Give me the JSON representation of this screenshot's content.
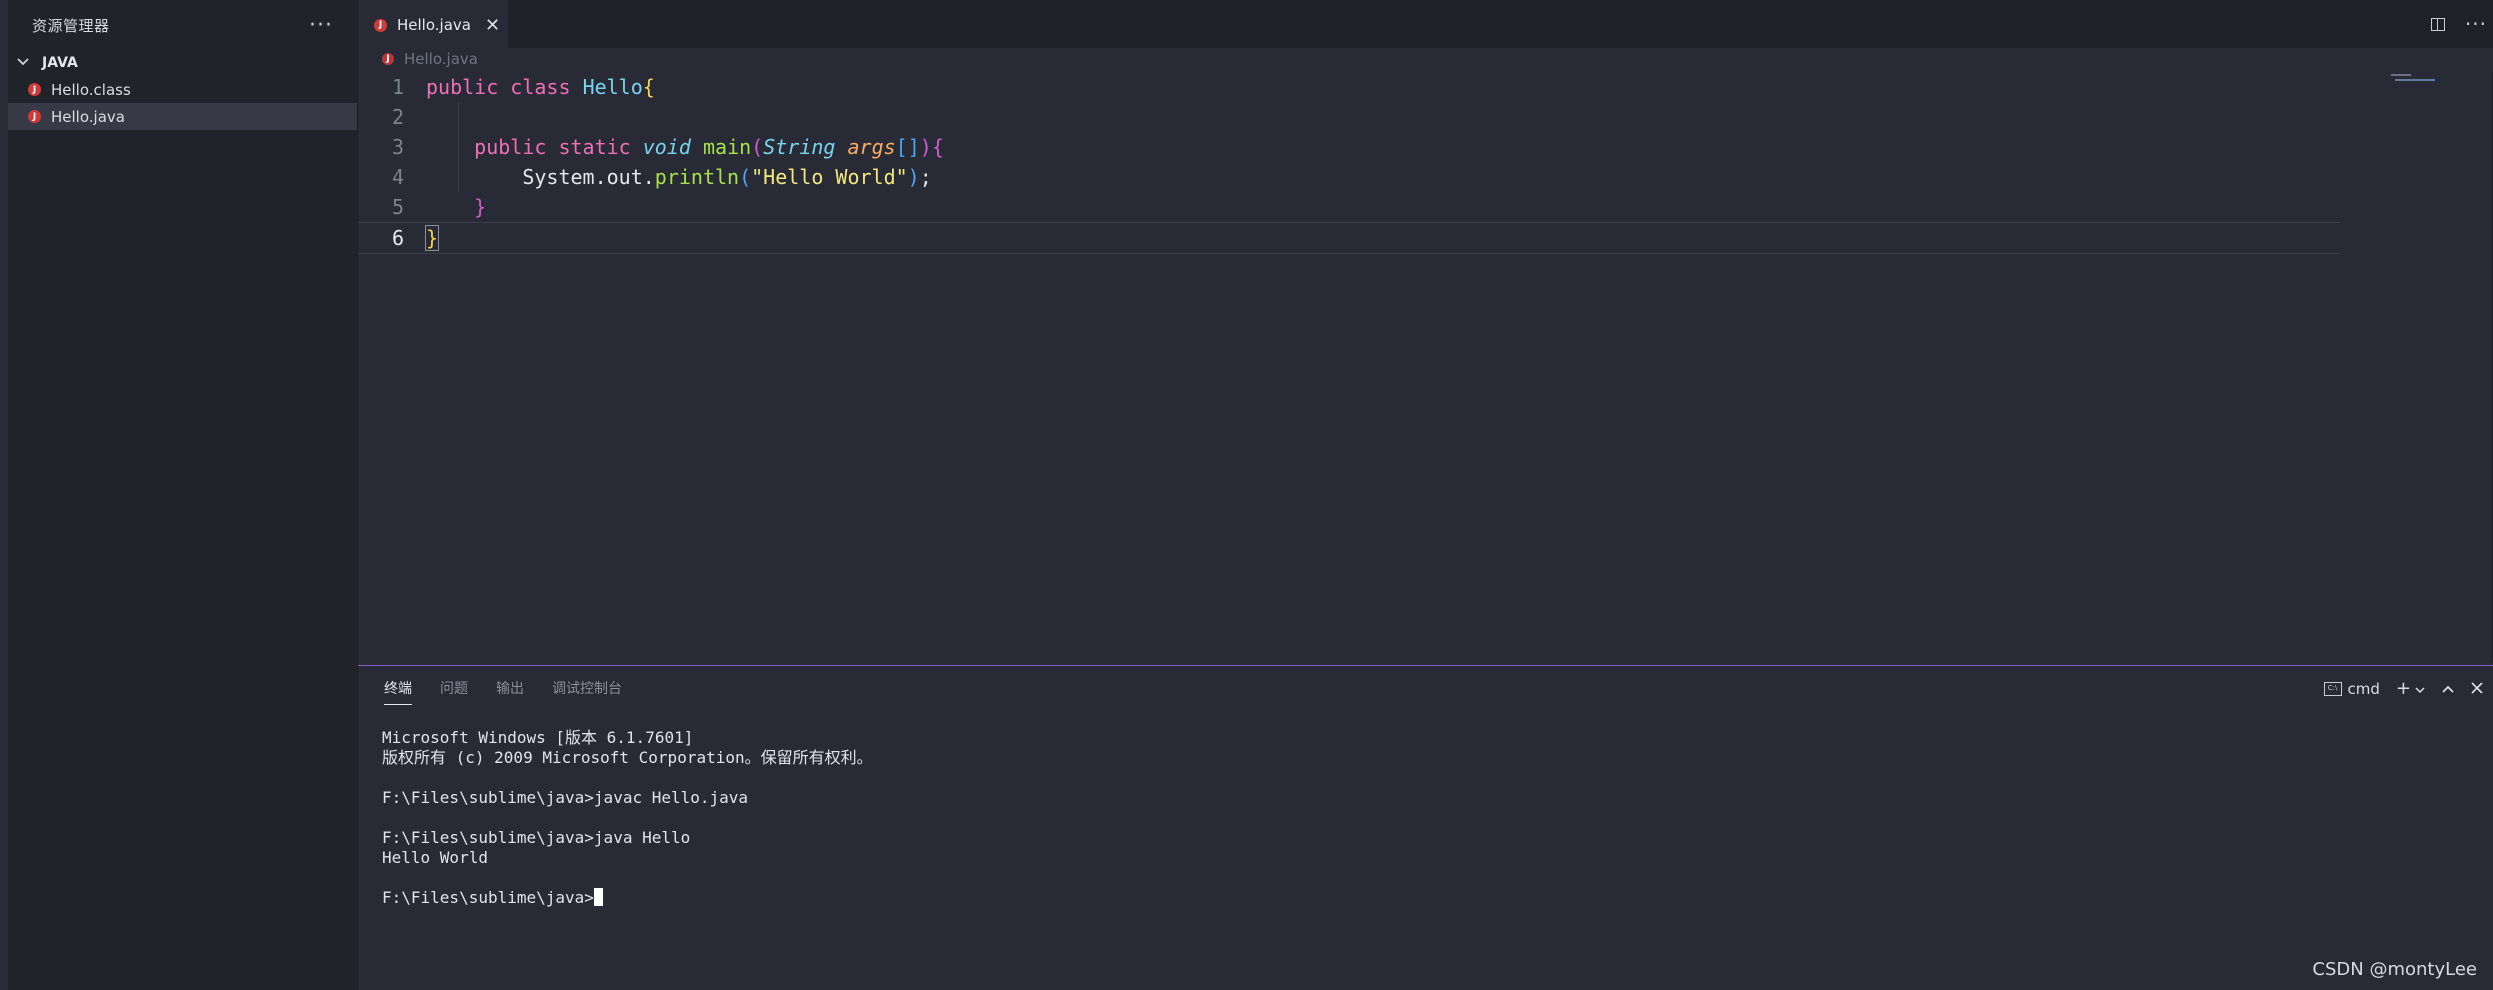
{
  "sidebar": {
    "title": "资源管理器",
    "more_label": "···",
    "section": "JAVA",
    "files": [
      {
        "name": "Hello.class",
        "selected": false
      },
      {
        "name": "Hello.java",
        "selected": true
      }
    ]
  },
  "editor": {
    "tab_label": "Hello.java",
    "tab_close": "✕",
    "breadcrumb": "Hello.java",
    "line_numbers": [
      "1",
      "2",
      "3",
      "4",
      "5",
      "6"
    ],
    "code_lines": [
      "public class Hello{",
      "",
      "    public static void main(String args[]){",
      "        System.out.println(\"Hello World\");",
      "    }",
      "}"
    ],
    "active_line": 6
  },
  "panel": {
    "tabs": [
      "终端",
      "问题",
      "输出",
      "调试控制台"
    ],
    "active_tab": "终端",
    "shell_label": "cmd",
    "terminal_lines": [
      "Microsoft Windows [版本 6.1.7601]",
      "版权所有 (c) 2009 Microsoft Corporation。保留所有权利。",
      "",
      "F:\\Files\\sublime\\java>javac Hello.java",
      "",
      "F:\\Files\\sublime\\java>java Hello",
      "Hello World",
      "",
      "F:\\Files\\sublime\\java>"
    ]
  },
  "watermark": "CSDN @montyLee",
  "colors": {
    "keyword": "#ee6fb5",
    "class": "#77d4f0",
    "function": "#a6e04a",
    "parameter": "#fbac62",
    "string": "#f2e77f",
    "java_icon": "#d23a3a",
    "panel_border": "#8a5fc9"
  },
  "icons": {
    "java_file": "java-file-icon",
    "split_editor": "split-editor-icon",
    "new_terminal": "plus-icon",
    "maximize": "chevron-up-icon",
    "close_panel": "close-icon"
  }
}
